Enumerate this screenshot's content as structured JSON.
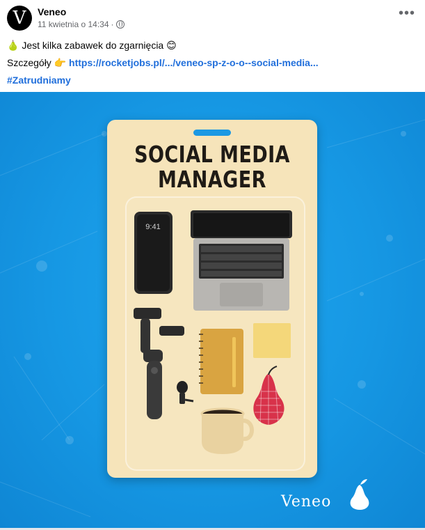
{
  "post": {
    "avatar_letter": "V",
    "author": "Veneo",
    "timestamp": "11 kwietnia o 14:34",
    "separator": "·",
    "more_label": "•••",
    "line1_emoji": "🍐",
    "line1_text": "Jest kilka zabawek do zgarnięcia",
    "line1_emoji2": "😊",
    "line2_prefix": "Szczegóły",
    "line2_emoji": "👉",
    "line2_link": "https://rocketjobs.pl/.../veneo-sp-z-o-o--social-media...",
    "line3_hashtag": "#Zatrudniamy"
  },
  "image": {
    "title_line1": "SOCIAL MEDIA",
    "title_line2": "MANAGER",
    "phone_time": "9:41",
    "brand": "Veneo",
    "colors": {
      "background": "#1697e3",
      "card": "#f6e4ba",
      "pear": "#d8324a",
      "notepad": "#d9a441",
      "sticky": "#f4d77a",
      "mug": "#e9d2a0"
    }
  }
}
